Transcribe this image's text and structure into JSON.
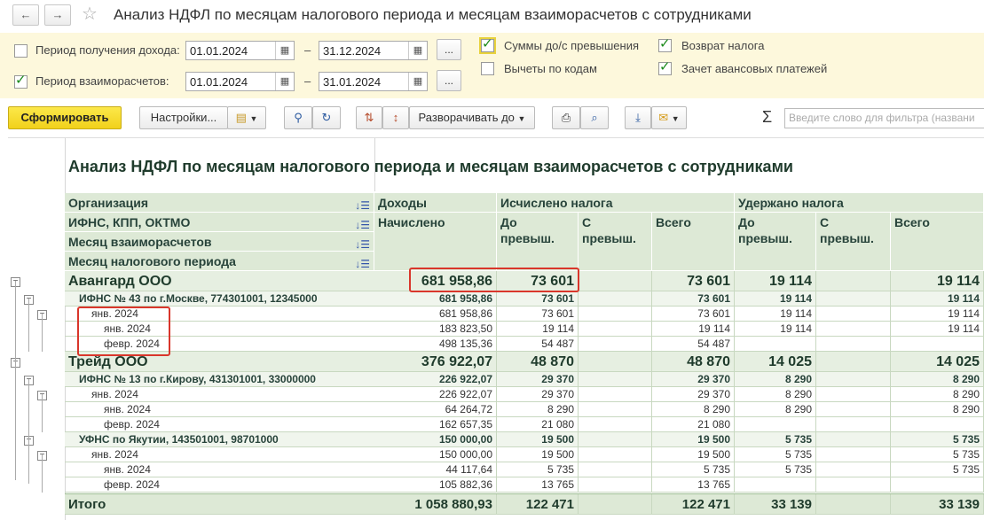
{
  "window": {
    "title": "Анализ НДФЛ по месяцам налогового периода и месяцам взаиморасчетов с сотрудниками",
    "back_icon": "←",
    "forward_icon": "→",
    "star_icon": "☆"
  },
  "params": {
    "income_period_label": "Период получения дохода:",
    "income_from": "01.01.2024",
    "income_to": "31.12.2024",
    "settle_period_label": "Период взаиморасчетов:",
    "settle_from": "01.01.2024",
    "settle_to": "31.01.2024",
    "dash": "–",
    "dots": "...",
    "sums_label": "Суммы до/с превышения",
    "deductions_label": "Вычеты по кодам",
    "refund_label": "Возврат налога",
    "offset_label": "Зачет авансовых платежей"
  },
  "toolbar": {
    "generate": "Сформировать",
    "settings": "Настройки...",
    "expand": "Разворачивать до",
    "sigma": "Σ",
    "search_placeholder": "Введите слово для фильтра (названи"
  },
  "report": {
    "title": "Анализ НДФЛ по месяцам налогового периода и месяцам взаиморасчетов с сотрудниками",
    "headers": {
      "org": "Организация",
      "ifns": "ИФНС, КПП, ОКТМО",
      "settle_month": "Месяц взаиморасчетов",
      "tax_month": "Месяц налогового периода",
      "income": "Доходы",
      "accrued": "Начислено",
      "calculated": "Исчислено налога",
      "withheld": "Удержано налога",
      "before": "До\nпревыш.",
      "after": "С\nпревыш.",
      "total": "Всего"
    },
    "rows": [
      {
        "level": 0,
        "label": "Авангард ООО",
        "values": [
          "681 958,86",
          "73 601",
          "",
          "73 601",
          "19 114",
          "",
          "19 114"
        ]
      },
      {
        "level": 1,
        "label": "ИФНС № 43 по г.Москве, 774301001, 12345000",
        "values": [
          "681 958,86",
          "73 601",
          "",
          "73 601",
          "19 114",
          "",
          "19 114"
        ]
      },
      {
        "level": 2,
        "label": "янв. 2024",
        "values": [
          "681 958,86",
          "73 601",
          "",
          "73 601",
          "19 114",
          "",
          "19 114"
        ]
      },
      {
        "level": 3,
        "label": "янв. 2024",
        "values": [
          "183 823,50",
          "19 114",
          "",
          "19 114",
          "19 114",
          "",
          "19 114"
        ]
      },
      {
        "level": 3,
        "label": "февр. 2024",
        "values": [
          "498 135,36",
          "54 487",
          "",
          "54 487",
          "",
          "",
          ""
        ]
      },
      {
        "level": 0,
        "label": "Трейд ООО",
        "values": [
          "376 922,07",
          "48 870",
          "",
          "48 870",
          "14 025",
          "",
          "14 025"
        ]
      },
      {
        "level": 1,
        "label": "ИФНС № 13 по г.Кирову, 431301001, 33000000",
        "values": [
          "226 922,07",
          "29 370",
          "",
          "29 370",
          "8 290",
          "",
          "8 290"
        ]
      },
      {
        "level": 2,
        "label": "янв. 2024",
        "values": [
          "226 922,07",
          "29 370",
          "",
          "29 370",
          "8 290",
          "",
          "8 290"
        ]
      },
      {
        "level": 3,
        "label": "янв. 2024",
        "values": [
          "64 264,72",
          "8 290",
          "",
          "8 290",
          "8 290",
          "",
          "8 290"
        ]
      },
      {
        "level": 3,
        "label": "февр. 2024",
        "values": [
          "162 657,35",
          "21 080",
          "",
          "21 080",
          "",
          "",
          ""
        ]
      },
      {
        "level": 1,
        "label": "УФНС по Якутии, 143501001, 98701000",
        "values": [
          "150 000,00",
          "19 500",
          "",
          "19 500",
          "5 735",
          "",
          "5 735"
        ]
      },
      {
        "level": 2,
        "label": "янв. 2024",
        "values": [
          "150 000,00",
          "19 500",
          "",
          "19 500",
          "5 735",
          "",
          "5 735"
        ]
      },
      {
        "level": 3,
        "label": "янв. 2024",
        "values": [
          "44 117,64",
          "5 735",
          "",
          "5 735",
          "5 735",
          "",
          "5 735"
        ]
      },
      {
        "level": 3,
        "label": "февр. 2024",
        "values": [
          "105 882,36",
          "13 765",
          "",
          "13 765",
          "",
          "",
          ""
        ]
      }
    ],
    "total_row": {
      "label": "Итого",
      "values": [
        "1 058 880,93",
        "122 471",
        "",
        "122 471",
        "33 139",
        "",
        "33 139"
      ]
    }
  }
}
